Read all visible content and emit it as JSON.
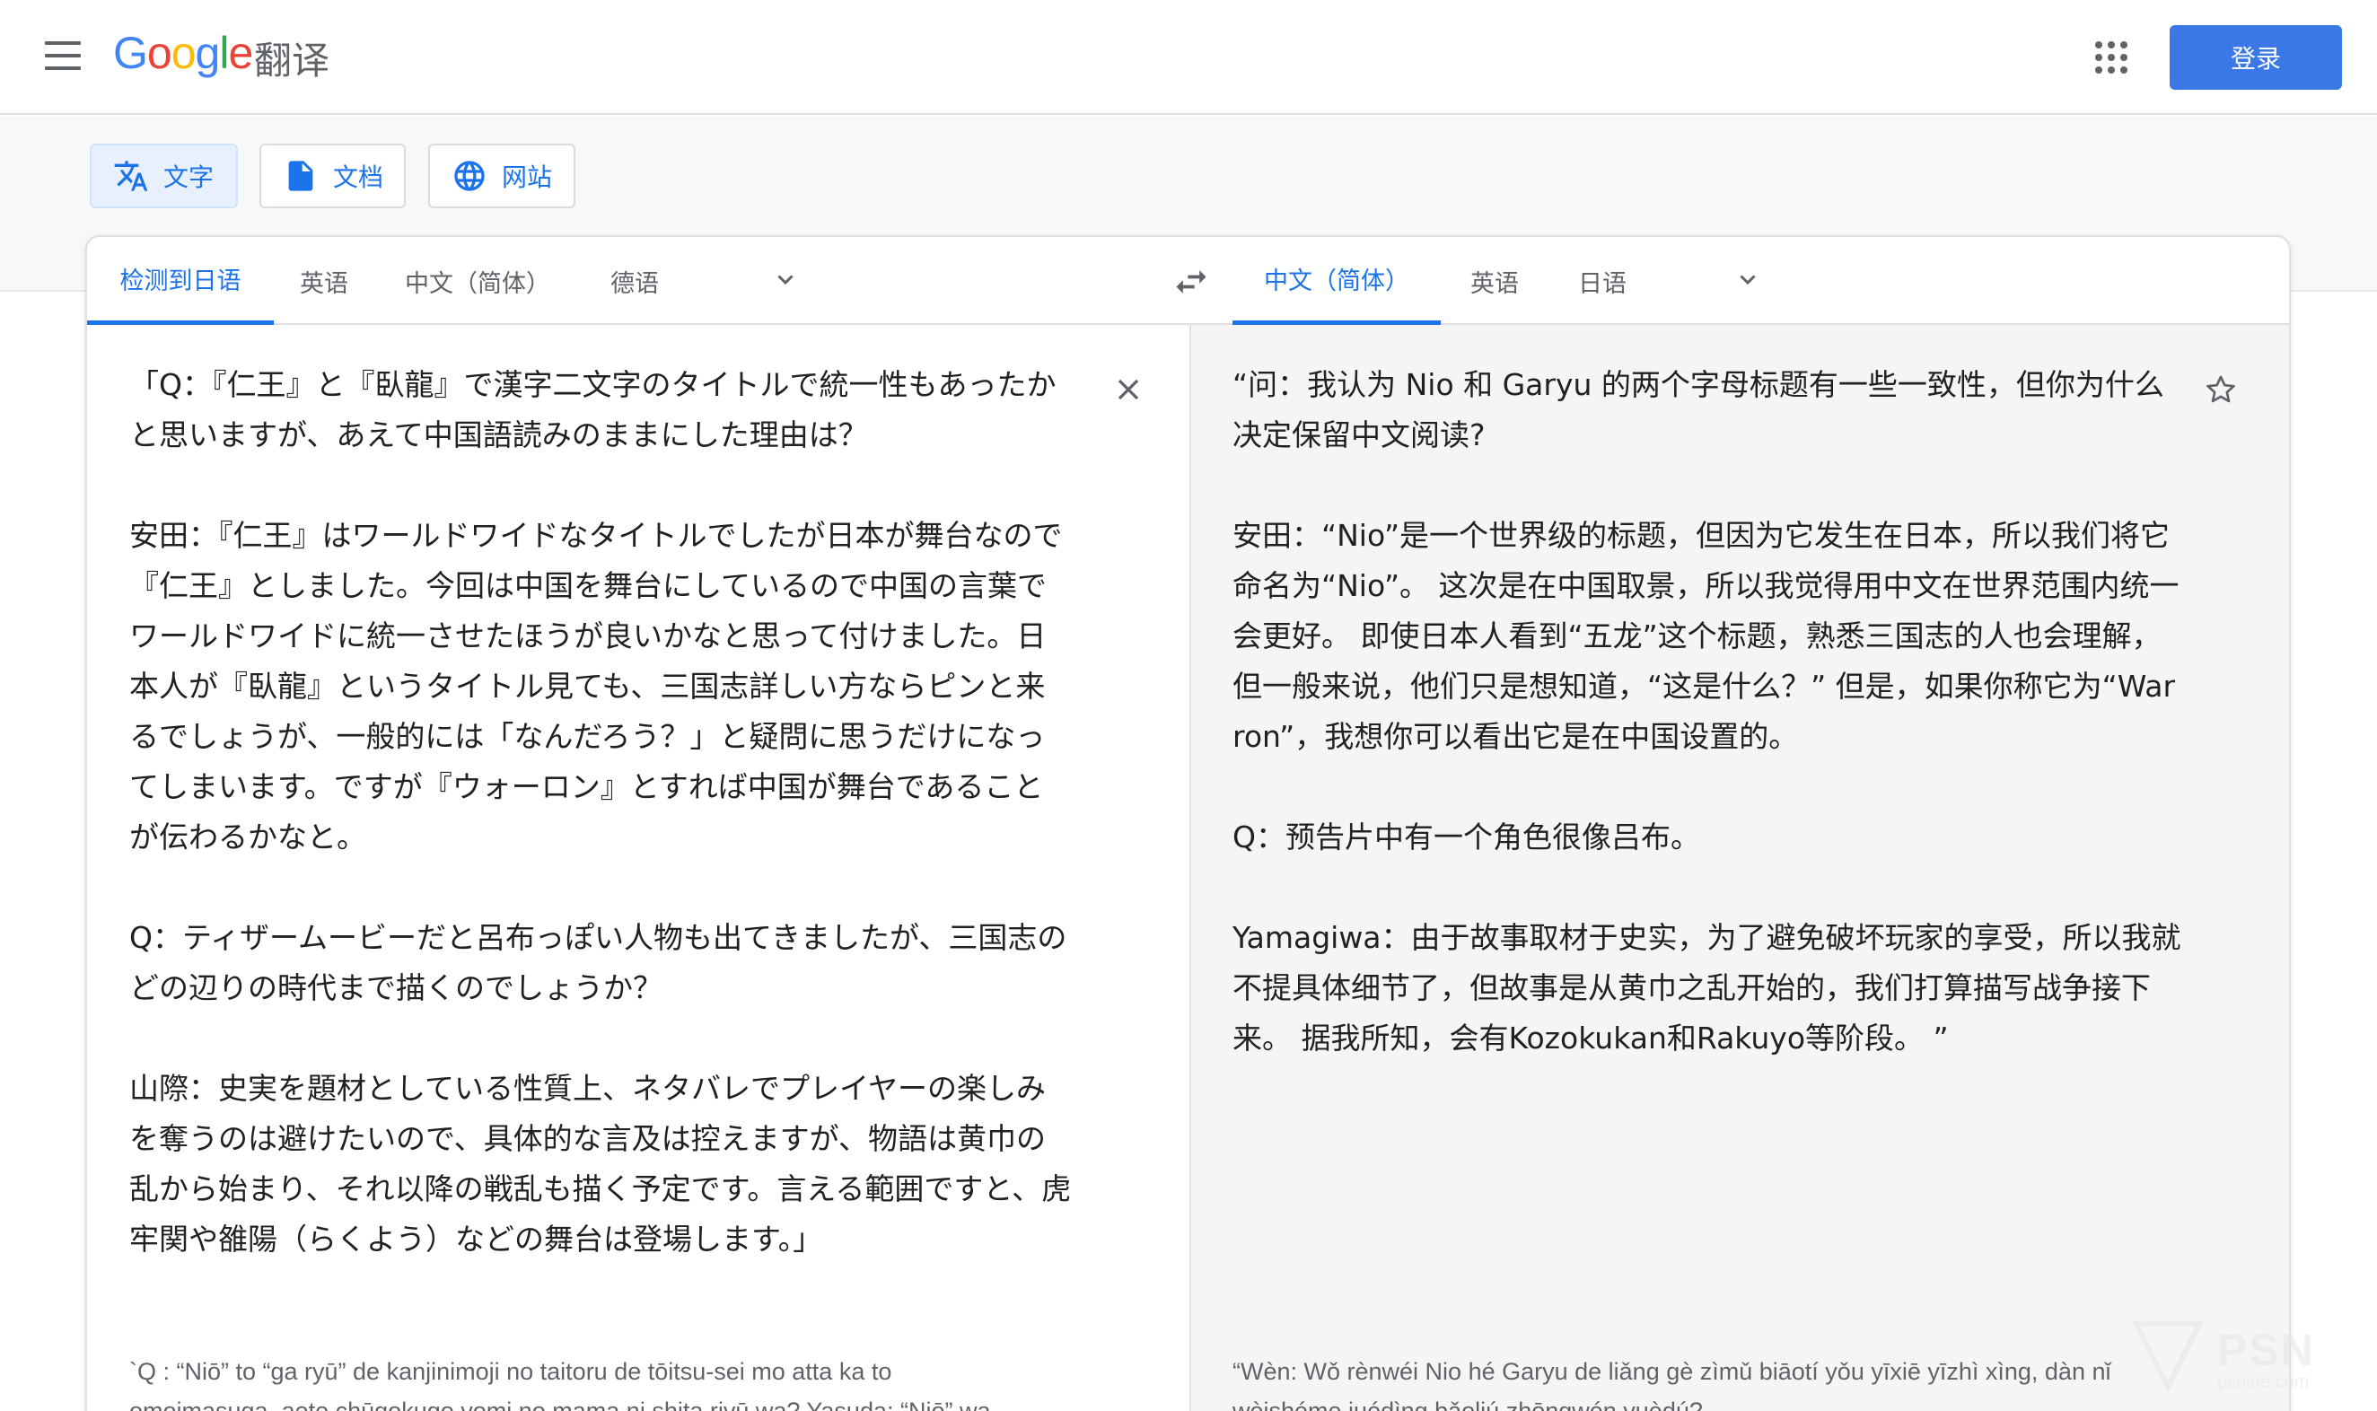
{
  "header": {
    "product_name": "翻译",
    "login_label": "登录"
  },
  "modes": [
    {
      "label": "文字",
      "icon": "translate-icon",
      "active": true
    },
    {
      "label": "文档",
      "icon": "document-icon",
      "active": false
    },
    {
      "label": "网站",
      "icon": "globe-icon",
      "active": false
    }
  ],
  "source_langs": [
    "检测到日语",
    "英语",
    "中文（简体）",
    "德语"
  ],
  "target_langs": [
    "中文（简体）",
    "英语",
    "日语"
  ],
  "source": {
    "text": "「Q：『仁王』と『臥龍』で漢字二文字のタイトルで統一性もあったかと思いますが、あえて中国語読みのままにした理由は？\n\n安田：『仁王』はワールドワイドなタイトルでしたが日本が舞台なので『仁王』としました。今回は中国を舞台にしているので中国の言葉でワールドワイドに統一させたほうが良いかなと思って付けました。日本人が『臥龍』というタイトル見ても、三国志詳しい方ならピンと来るでしょうが、一般的には「なんだろう？」と疑問に思うだけになってしまいます。ですが『ウォーロン』とすれば中国が舞台であることが伝わるかなと。\n\nQ：ティザームービーだと呂布っぽい人物も出てきましたが、三国志のどの辺りの時代まで描くのでしょうか？\n\n山際：史実を題材としている性質上、ネタバレでプレイヤーの楽しみを奪うのは避けたいので、具体的な言及は控えますが、物語は黄巾の乱から始まり、それ以降の戦乱も描く予定です。言える範囲ですと、虎牢関や雒陽（らくよう）などの舞台は登場します。」",
    "romanization": "`Q : “Niō” to “ga ryū” de kanjinimoji no taitoru de tōitsu-sei mo atta ka to\nomoimasuga, aete chūgokugo yomi no mama ni shita riyū wa? Yasuda: “Niō” wa"
  },
  "target": {
    "text": "“问：我认为 Nio 和 Garyu 的两个字母标题有一些一致性，但你为什么决定保留中文阅读?\n\n安田：“Nio”是一个世界级的标题，但因为它发生在日本，所以我们将它命名为“Nio”。 这次是在中国取景，所以我觉得用中文在世界范围内统一会更好。 即使日本人看到“五龙”这个标题，熟悉三国志的人也会理解，但一般来说，他们只是想知道，“这是什么？” 但是，如果你称它为“Warron”，我想你可以看出它是在中国设置的。\n\nQ：预告片中有一个角色很像吕布。\n\nYamagiwa：由于故事取材于史实，为了避免破坏玩家的享受，所以我就不提具体细节了，但故事是从黄巾之乱开始的，我们打算描写战争接下来。 据我所知，会有Kozokukan和Rakuyo等阶段。 ”",
    "romanization": "“Wèn: Wǒ rènwéi Nio hé Garyu de liǎng gè zìmǔ biāotí yǒu yīxiē yīzhì xìng, dàn nǐ\nwèishéme juédìng bǎoliú zhōngwén yuèdú?"
  },
  "watermark": {
    "text": "PSN",
    "sub": "psnine.com"
  },
  "colors": {
    "accent": "#1a73e8",
    "login_bg": "#3b78e7",
    "right_pane_bg": "#f5f5f5"
  }
}
